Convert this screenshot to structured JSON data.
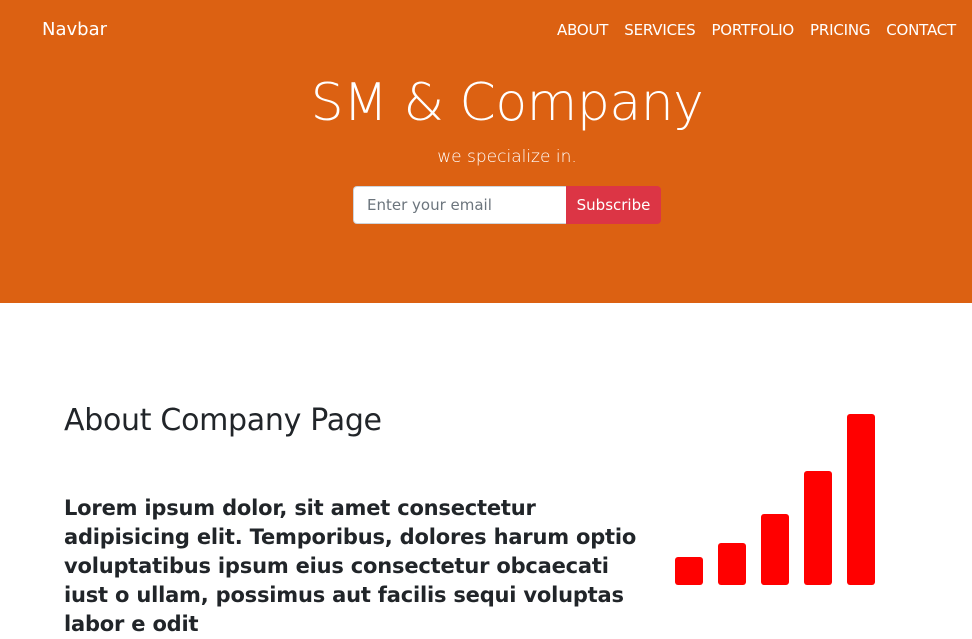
{
  "navbar": {
    "brand": "Navbar",
    "links": [
      "ABOUT",
      "SERVICES",
      "PORTFOLIO",
      "PRICING",
      "CONTACT"
    ]
  },
  "hero": {
    "title": "SM & Company",
    "subtitle": "we specialize in.",
    "email_placeholder": "Enter your email",
    "subscribe_label": "Subscribe"
  },
  "about": {
    "title": "About Company Page",
    "text": "Lorem ipsum dolor, sit amet consectetur adipisicing elit. Temporibus, dolores harum optio voluptatibus ipsum eius consectetur obcaecati iust o ullam, possimus aut facilis sequi voluptas labor e odit"
  },
  "icon": {
    "name": "signal-bars-icon",
    "bar_levels": [
      1,
      2,
      3,
      4,
      5
    ]
  },
  "colors": {
    "hero_background": "#dc6112",
    "subscribe_button": "#dc3545",
    "icon_bars": "#ff0000",
    "body_text": "#212529"
  }
}
